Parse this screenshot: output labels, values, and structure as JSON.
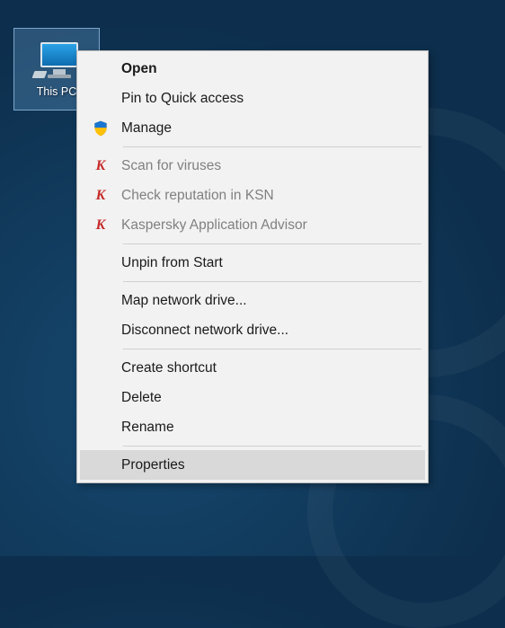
{
  "desktop": {
    "icon_label": "This PC"
  },
  "contextMenu": {
    "items": {
      "open": "Open",
      "pin_quick_access": "Pin to Quick access",
      "manage": "Manage",
      "scan_viruses": "Scan for viruses",
      "check_ksn": "Check reputation in KSN",
      "kaspersky_advisor": "Kaspersky Application Advisor",
      "unpin_start": "Unpin from Start",
      "map_drive": "Map network drive...",
      "disconnect_drive": "Disconnect network drive...",
      "create_shortcut": "Create shortcut",
      "delete": "Delete",
      "rename": "Rename",
      "properties": "Properties"
    }
  }
}
